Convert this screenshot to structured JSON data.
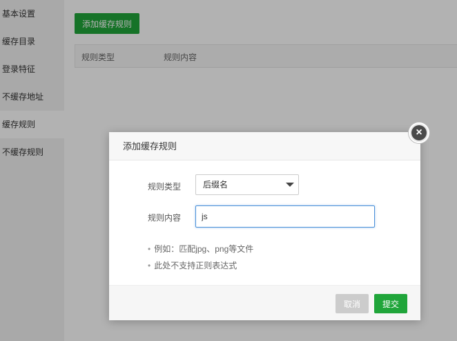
{
  "sidebar": {
    "items": [
      {
        "label": "基本设置"
      },
      {
        "label": "缓存目录"
      },
      {
        "label": "登录特征"
      },
      {
        "label": "不缓存地址"
      },
      {
        "label": "缓存规则"
      },
      {
        "label": "不缓存规则"
      }
    ],
    "active_index": 4
  },
  "main": {
    "add_button_label": "添加缓存规则",
    "table": {
      "columns": [
        "规则类型",
        "规则内容"
      ]
    }
  },
  "modal": {
    "title": "添加缓存规则",
    "fields": {
      "type_label": "规则类型",
      "type_value": "后缀名",
      "content_label": "规则内容",
      "content_value": "js"
    },
    "tips": [
      "例如：匹配jpg、png等文件",
      "此处不支持正则表达式"
    ],
    "cancel_label": "取消",
    "submit_label": "提交",
    "close_icon": "close-icon"
  },
  "colors": {
    "accent": "#20a53a",
    "input_focus": "#4a90d9",
    "disabled": "#cccccc"
  }
}
